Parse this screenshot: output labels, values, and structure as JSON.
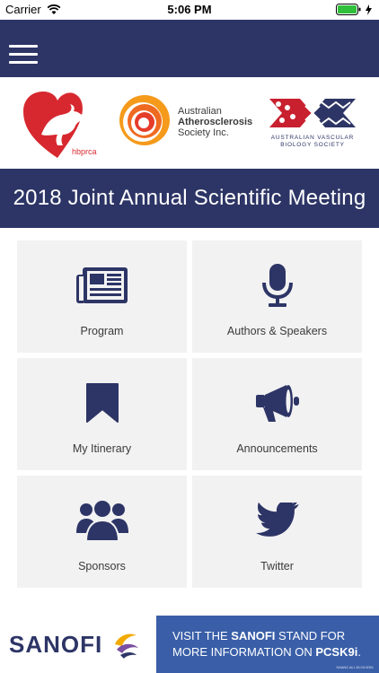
{
  "status": {
    "carrier": "Carrier",
    "time": "5:06 PM"
  },
  "logos": {
    "hbprca": "hbprca",
    "aas_line1": "Australian",
    "aas_line2": "Atherosclerosis",
    "aas_line3": "Society Inc.",
    "avbs_line1": "AUSTRALIAN VASCULAR",
    "avbs_line2": "BIOLOGY SOCIETY"
  },
  "banner": {
    "title": "2018 Joint Annual Scientific Meeting"
  },
  "tiles": [
    {
      "label": "Program",
      "icon": "newspaper-icon"
    },
    {
      "label": "Authors & Speakers",
      "icon": "microphone-icon"
    },
    {
      "label": "My Itinerary",
      "icon": "bookmark-icon"
    },
    {
      "label": "Announcements",
      "icon": "megaphone-icon"
    },
    {
      "label": "Sponsors",
      "icon": "group-icon"
    },
    {
      "label": "Twitter",
      "icon": "twitter-bird-icon"
    }
  ],
  "ad": {
    "brand": "SANOFI",
    "line1_pre": "VISIT THE ",
    "line1_brand": "SANOFI",
    "line1_post": " STAND FOR",
    "line2_pre": "MORE INFORMATION ON ",
    "line2_bold": "PCSK9i",
    "line2_post": ".",
    "code": "SAANZ.ALI.18.03.0051"
  },
  "colors": {
    "nav": "#2d3566",
    "tile_bg": "#f2f2f3",
    "icon": "#2d3566",
    "ad_blue": "#3a5fa8"
  }
}
